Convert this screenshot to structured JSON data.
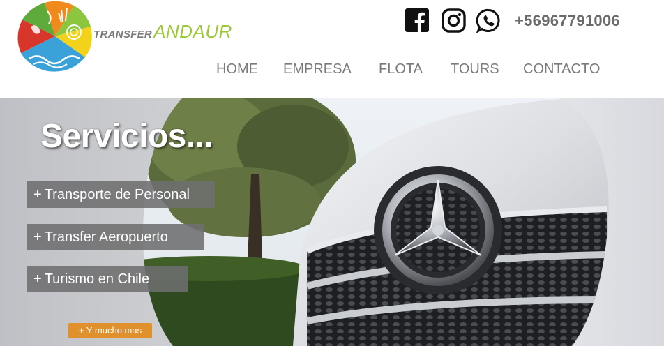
{
  "header": {
    "brand_small": "TRANSFER",
    "brand_big": "ANDAUR",
    "phone": "+56967791006",
    "social_icons": [
      "facebook-icon",
      "instagram-icon",
      "whatsapp-icon"
    ]
  },
  "nav": {
    "items": [
      {
        "label": "HOME"
      },
      {
        "label": "EMPRESA"
      },
      {
        "label": "FLOTA"
      },
      {
        "label": "TOURS"
      },
      {
        "label": "CONTACTO"
      }
    ]
  },
  "hero": {
    "title": "Servicios...",
    "services": [
      {
        "plus": "+",
        "label": "Transporte de Personal"
      },
      {
        "plus": "+",
        "label": "Transfer Aeropuerto"
      },
      {
        "plus": "+",
        "label": "Turismo en Chile"
      }
    ],
    "more_button": "+ Y mucho mas"
  },
  "colors": {
    "nav_text": "#7a7a7a",
    "brand_green": "#9bc83a",
    "service_box": "#6e6e70",
    "more_button": "#e0902c"
  }
}
